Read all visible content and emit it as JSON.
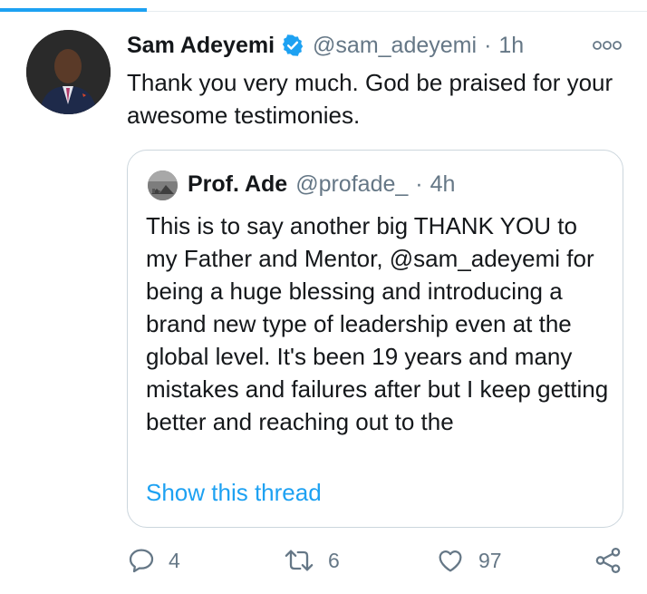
{
  "tweet": {
    "display_name": "Sam Adeyemi",
    "handle": "@sam_adeyemi",
    "separator": "·",
    "time": "1h",
    "text": "Thank you very much. God be praised for your awesome testimonies.",
    "verified": true,
    "avatar": "profile-photo",
    "more_icon": "more-options-icon"
  },
  "quoted_tweet": {
    "display_name": "Prof. Ade",
    "handle": "@profade_",
    "separator": "·",
    "time": "4h",
    "text": "This is to say another big THANK YOU to my Father and Mentor, @sam_adeyemi for being a huge blessing and introducing a brand new type of leadership even at the global level. It's been 19 years and many mistakes and failures after but I keep getting better and reaching out to the",
    "show_thread": "Show this thread"
  },
  "actions": {
    "reply": {
      "icon": "reply-icon",
      "count": "4"
    },
    "retweet": {
      "icon": "retweet-icon",
      "count": "6"
    },
    "like": {
      "icon": "heart-icon",
      "count": "97"
    },
    "share": {
      "icon": "share-icon"
    }
  },
  "colors": {
    "accent": "#1da1f2",
    "text": "#14171a",
    "secondary": "#657786",
    "border": "#ccd6dd"
  }
}
